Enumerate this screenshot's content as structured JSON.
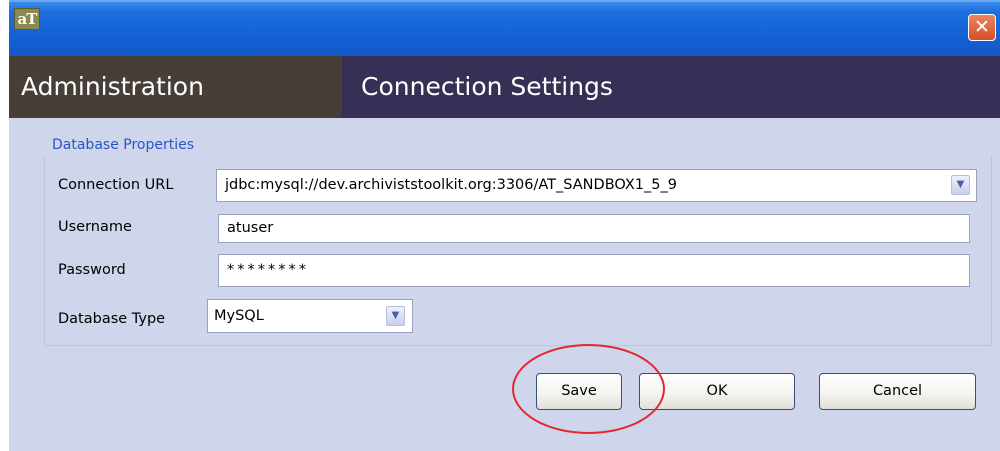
{
  "window": {
    "icon_text": "aT",
    "close_glyph": "✕"
  },
  "header": {
    "section": "Administration",
    "title": "Connection Settings"
  },
  "database_properties": {
    "group_label": "Database Properties",
    "connection_url": {
      "label": "Connection URL",
      "value": "jdbc:mysql://dev.archiviststoolkit.org:3306/AT_SANDBOX1_5_9"
    },
    "username": {
      "label": "Username",
      "value": "atuser"
    },
    "password": {
      "label": "Password",
      "value": "********"
    },
    "database_type": {
      "label": "Database Type",
      "value": "MySQL"
    }
  },
  "buttons": {
    "save": "Save",
    "ok": "OK",
    "cancel": "Cancel"
  },
  "colors": {
    "titlebar": "#1464d8",
    "header_admin": "#483e38",
    "header_main": "#382f57",
    "body": "#cfd5ea",
    "group_label": "#2a55c9",
    "highlight": "#e3272e"
  },
  "icons": {
    "app": "app-icon",
    "close": "close-icon",
    "dropdown": "chevron-down-icon"
  }
}
